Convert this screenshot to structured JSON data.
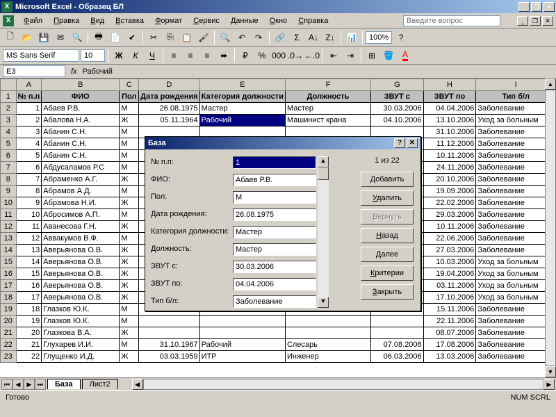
{
  "title": "Microsoft Excel - Образец БЛ",
  "menu": [
    "Файл",
    "Правка",
    "Вид",
    "Вставка",
    "Формат",
    "Сервис",
    "Данные",
    "Окно",
    "Справка"
  ],
  "question_placeholder": "Введите вопрос",
  "zoom": "100%",
  "font_name": "MS Sans Serif",
  "font_size": "10",
  "name_box": "E3",
  "fx_label": "fx",
  "formula_value": "Рабочий",
  "columns": [
    "A",
    "B",
    "C",
    "D",
    "E",
    "F",
    "G",
    "H",
    "I"
  ],
  "headers": {
    "A": "№ п.п",
    "B": "ФИО",
    "C": "Пол",
    "D": "Дата рождения",
    "E": "Категория должности",
    "F": "Должность",
    "G": "ЗВУТ с",
    "H": "ЗВУТ по",
    "I": "Тип б/л"
  },
  "rows": [
    {
      "n": 1,
      "fio": "Абаев Р.В.",
      "pol": "М",
      "dr": "26.08.1975",
      "cat": "Мастер",
      "dol": "Мастер",
      "zs": "30.03.2006",
      "zp": "04.04.2006",
      "tip": "Заболевание"
    },
    {
      "n": 2,
      "fio": "Абалова Н.А.",
      "pol": "Ж",
      "dr": "05.11.1964",
      "cat": "Рабочий",
      "dol": "Машинист крана",
      "zs": "04.10.2006",
      "zp": "13.10.2006",
      "tip": "Уход за больным"
    },
    {
      "n": 3,
      "fio": "Абанин С.Н.",
      "pol": "М",
      "dr": "",
      "cat": "",
      "dol": "",
      "zs": "",
      "zp": "31.10.2006",
      "tip": "Заболевание"
    },
    {
      "n": 4,
      "fio": "Абанин С.Н.",
      "pol": "М",
      "dr": "",
      "cat": "",
      "dol": "",
      "zs": "",
      "zp": "11.12.2006",
      "tip": "Заболевание"
    },
    {
      "n": 5,
      "fio": "Абанин С.Н.",
      "pol": "М",
      "dr": "",
      "cat": "",
      "dol": "",
      "zs": "",
      "zp": "10.11.2006",
      "tip": "Заболевание"
    },
    {
      "n": 6,
      "fio": "Абдусаламов Р.С",
      "pol": "М",
      "dr": "",
      "cat": "",
      "dol": "",
      "zs": "",
      "zp": "24.11.2006",
      "tip": "Заболевание"
    },
    {
      "n": 7,
      "fio": "Абраменко А.Г.",
      "pol": "Ж",
      "dr": "",
      "cat": "",
      "dol": "",
      "zs": "",
      "zp": "20.10.2006",
      "tip": "Заболевание"
    },
    {
      "n": 8,
      "fio": "Абрамов А.Д.",
      "pol": "М",
      "dr": "",
      "cat": "",
      "dol": "",
      "zs": "",
      "zp": "19.09.2006",
      "tip": "Заболевание"
    },
    {
      "n": 9,
      "fio": "Абрамова Н.И.",
      "pol": "Ж",
      "dr": "",
      "cat": "",
      "dol": "",
      "zs": "",
      "zp": "22.02.2006",
      "tip": "Заболевание"
    },
    {
      "n": 10,
      "fio": "Абросимов А.П.",
      "pol": "М",
      "dr": "",
      "cat": "",
      "dol": "",
      "zs": "",
      "zp": "29.03.2006",
      "tip": "Заболевание"
    },
    {
      "n": 11,
      "fio": "Аванесова Г.Н.",
      "pol": "Ж",
      "dr": "",
      "cat": "",
      "dol": "",
      "zs": "",
      "zp": "10.11.2006",
      "tip": "Заболевание"
    },
    {
      "n": 12,
      "fio": "Аввакумов В.Ф.",
      "pol": "М",
      "dr": "",
      "cat": "",
      "dol": "",
      "zs": "",
      "zp": "22.06.2006",
      "tip": "Заболевание"
    },
    {
      "n": 13,
      "fio": "Аверьянова О.В.",
      "pol": "Ж",
      "dr": "",
      "cat": "",
      "dol": "",
      "zs": "",
      "zp": "27.03.2006",
      "tip": "Заболевание"
    },
    {
      "n": 14,
      "fio": "Аверьянова О.В.",
      "pol": "Ж",
      "dr": "",
      "cat": "",
      "dol": "",
      "zs": "",
      "zp": "10.03.2006",
      "tip": "Уход за больным"
    },
    {
      "n": 15,
      "fio": "Аверьянова О.В.",
      "pol": "Ж",
      "dr": "",
      "cat": "",
      "dol": "",
      "zs": "",
      "zp": "19.04.2006",
      "tip": "Уход за больным"
    },
    {
      "n": 16,
      "fio": "Аверьянова О.В.",
      "pol": "Ж",
      "dr": "",
      "cat": "",
      "dol": "",
      "zs": "",
      "zp": "03.11.2006",
      "tip": "Уход за больным"
    },
    {
      "n": 17,
      "fio": "Аверьянова О.В.",
      "pol": "Ж",
      "dr": "",
      "cat": "",
      "dol": "",
      "zs": "",
      "zp": "17.10.2006",
      "tip": "Уход за больным"
    },
    {
      "n": 18,
      "fio": "Глазков Ю.К.",
      "pol": "М",
      "dr": "",
      "cat": "",
      "dol": "",
      "zs": "",
      "zp": "15.11.2006",
      "tip": "Заболевание"
    },
    {
      "n": 19,
      "fio": "Глазков Ю.К.",
      "pol": "М",
      "dr": "",
      "cat": "",
      "dol": "",
      "zs": "",
      "zp": "22.11.2006",
      "tip": "Заболевание"
    },
    {
      "n": 20,
      "fio": "Глазкова В.А.",
      "pol": "Ж",
      "dr": "",
      "cat": "",
      "dol": "",
      "zs": "",
      "zp": "08.07.2006",
      "tip": "Заболевание"
    },
    {
      "n": 21,
      "fio": "Глухарев И.И.",
      "pol": "М",
      "dr": "31.10.1967",
      "cat": "Рабочий",
      "dol": "Слесарь",
      "zs": "07.08.2006",
      "zp": "17.08.2006",
      "tip": "Заболевание"
    },
    {
      "n": 22,
      "fio": "Глущенко И.Д.",
      "pol": "Ж",
      "dr": "03.03.1959",
      "cat": "ИТР",
      "dol": "Инженер",
      "zs": "06.03.2006",
      "zp": "13.03.2006",
      "tip": "Заболевание"
    }
  ],
  "tabs": {
    "active": "База",
    "other": "Лист2"
  },
  "status": {
    "left": "Готово",
    "right": "NUM SCRL"
  },
  "dialog": {
    "title": "База",
    "counter": "1 из 22",
    "fields": [
      {
        "label": "№ п.п:",
        "value": "1",
        "sel": true
      },
      {
        "label": "ФИО:",
        "value": "Абаев Р.В."
      },
      {
        "label": "Пол:",
        "value": "М"
      },
      {
        "label": "Дата рождения:",
        "value": "26.08.1975"
      },
      {
        "label": "Категория должности:",
        "value": "Мастер"
      },
      {
        "label": "Должность:",
        "value": "Мастер"
      },
      {
        "label": "ЗВУТ с:",
        "value": "30.03.2006"
      },
      {
        "label": "ЗВУТ по:",
        "value": "04.04.2006"
      },
      {
        "label": "Тип б/л:",
        "value": "Заболевание"
      }
    ],
    "buttons": [
      {
        "label": "Добавить"
      },
      {
        "label": "Удалить"
      },
      {
        "label": "Вернуть",
        "disabled": true
      },
      {
        "label": "Назад"
      },
      {
        "label": "Далее"
      },
      {
        "label": "Критерии"
      },
      {
        "label": "Закрыть"
      }
    ]
  }
}
